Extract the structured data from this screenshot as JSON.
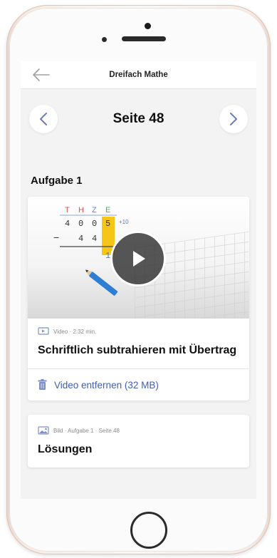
{
  "app": {
    "title": "Dreifach Mathe",
    "back_icon": "back-arrow-icon"
  },
  "pager": {
    "title": "Seite 48",
    "prev_icon": "chevron-left-icon",
    "next_icon": "chevron-right-icon"
  },
  "section": {
    "title": "Aufgabe 1"
  },
  "video_card": {
    "meta": "Video · 2:32 min.",
    "title": "Schriftlich subtrahieren mit Übertrag",
    "action_label": "Video entfernen (32 MB)",
    "action_icon": "trash-icon",
    "thumbnail": {
      "headers": [
        "T",
        "H",
        "Z",
        "E"
      ],
      "row1": [
        "4",
        "0",
        "0",
        "5"
      ],
      "row2": [
        "4",
        "4"
      ],
      "minus": "−",
      "carry": "+10",
      "result_digit": "1"
    }
  },
  "image_card": {
    "meta": "Bild · Aufgabe 1 · Seite 48",
    "title": "Lösungen"
  },
  "colors": {
    "accent": "#3f5fb5",
    "highlight": "#f5c518",
    "pencil": "#2e7fd4"
  }
}
